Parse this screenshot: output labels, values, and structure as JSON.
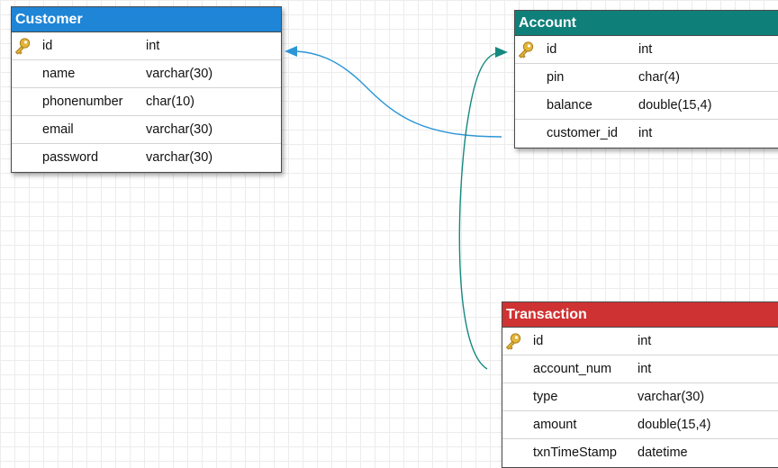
{
  "colors": {
    "customer_header": "#1f85d6",
    "account_header": "#0f7f7a",
    "transaction_header": "#cf3232",
    "customer_relation_line": "#2b95d6",
    "account_relation_line": "#15897f",
    "key_icon": "#e3b43a",
    "grid": "#ececec"
  },
  "tables": {
    "customer": {
      "title": "Customer",
      "rows": [
        {
          "name": "id",
          "type": "int",
          "pk": true
        },
        {
          "name": "name",
          "type": "varchar(30)",
          "pk": false
        },
        {
          "name": "phonenumber",
          "type": "char(10)",
          "pk": false
        },
        {
          "name": "email",
          "type": "varchar(30)",
          "pk": false
        },
        {
          "name": "password",
          "type": "varchar(30)",
          "pk": false
        }
      ]
    },
    "account": {
      "title": "Account",
      "rows": [
        {
          "name": "id",
          "type": "int",
          "pk": true
        },
        {
          "name": "pin",
          "type": "char(4)",
          "pk": false
        },
        {
          "name": "balance",
          "type": "double(15,4)",
          "pk": false
        },
        {
          "name": "customer_id",
          "type": "int",
          "pk": false
        }
      ]
    },
    "transaction": {
      "title": "Transaction",
      "rows": [
        {
          "name": "id",
          "type": "int",
          "pk": true
        },
        {
          "name": "account_num",
          "type": "int",
          "pk": false
        },
        {
          "name": "type",
          "type": "varchar(30)",
          "pk": false
        },
        {
          "name": "amount",
          "type": "double(15,4)",
          "pk": false
        },
        {
          "name": "txnTimeStamp",
          "type": "datetime",
          "pk": false
        }
      ]
    }
  },
  "relations": [
    {
      "from": "account.customer_id",
      "to": "customer.id"
    },
    {
      "from": "transaction.account_num",
      "to": "account.id"
    }
  ]
}
